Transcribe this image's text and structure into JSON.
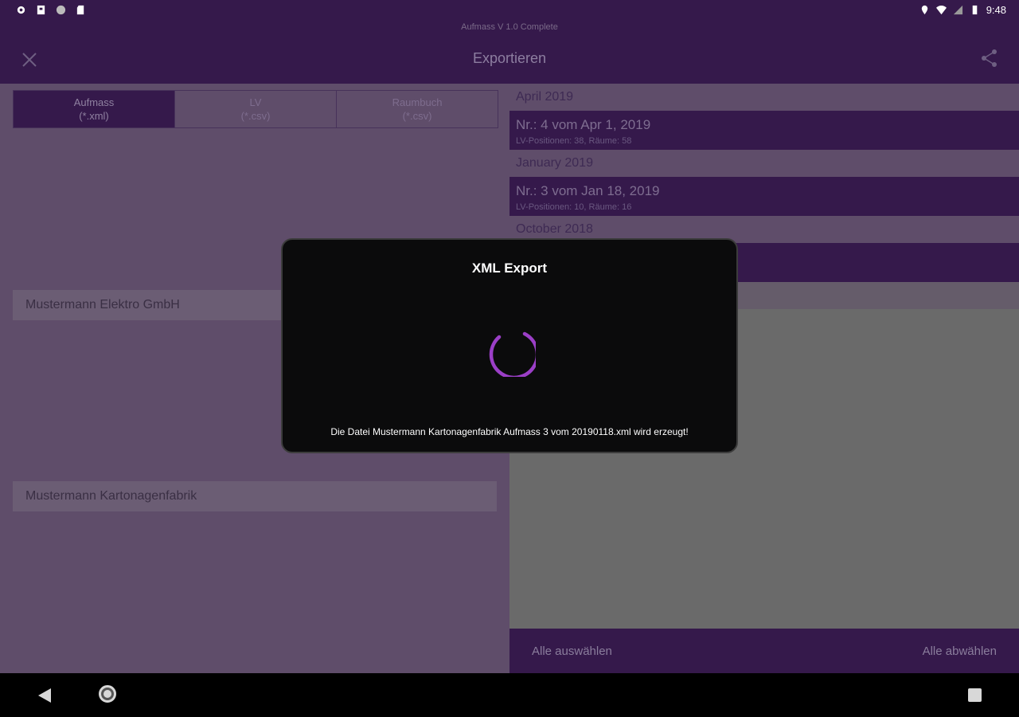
{
  "status_bar": {
    "left_icons": [
      "gear-icon",
      "sd-icon",
      "circle-icon",
      "sim-icon"
    ],
    "right_icons": [
      "location-icon",
      "wifi-icon",
      "signal-icon",
      "battery-icon"
    ],
    "time": "9:48"
  },
  "app_bar": {
    "subtitle": "Aufmass V 1.0 Complete",
    "title": "Exportieren",
    "close_icon": "close-icon",
    "share_icon": "share-icon"
  },
  "tabs": [
    {
      "label": "Aufmass",
      "ext": "(*.xml)",
      "active": true
    },
    {
      "label": "LV",
      "ext": "(*.csv)",
      "active": false
    },
    {
      "label": "Raumbuch",
      "ext": "(*.csv)",
      "active": false
    }
  ],
  "companies": [
    "Mustermann Elektro GmbH",
    "Mustermann Kartonagenfabrik"
  ],
  "export_list": [
    {
      "month": "April 2019",
      "entry": {
        "title": "Nr.: 4 vom Apr 1, 2019",
        "detail": "LV-Positionen: 38, Räume: 58"
      }
    },
    {
      "month": "January 2019",
      "entry": {
        "title": "Nr.: 3 vom Jan 18, 2019",
        "detail": "LV-Positionen: 10, Räume: 16"
      }
    },
    {
      "month": "October 2018",
      "entry": {
        "title": "",
        "detail": ""
      }
    }
  ],
  "bottom_bar": {
    "select_all": "Alle auswählen",
    "deselect_all": "Alle abwählen"
  },
  "dialog": {
    "title": "XML Export",
    "message": "Die Datei Mustermann Kartonagenfabrik Aufmass 3 vom 20190118.xml wird erzeugt!",
    "spinner_color": "#9b3fc7"
  },
  "nav_bar": {
    "back_icon": "back-icon",
    "home_icon": "home-icon",
    "recents_icon": "recents-icon"
  },
  "colors": {
    "primary_dark": "#35194b",
    "overlay_bg": "#5f4d6a"
  }
}
